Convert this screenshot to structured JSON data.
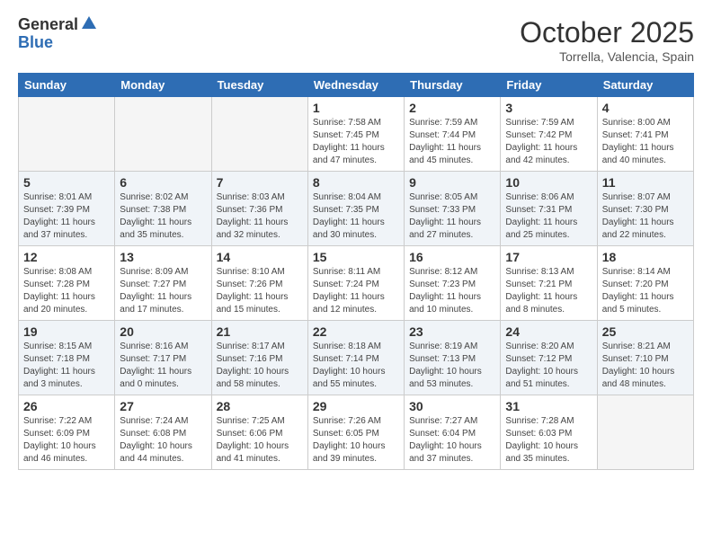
{
  "logo": {
    "general": "General",
    "blue": "Blue"
  },
  "title": "October 2025",
  "location": "Torrella, Valencia, Spain",
  "days_of_week": [
    "Sunday",
    "Monday",
    "Tuesday",
    "Wednesday",
    "Thursday",
    "Friday",
    "Saturday"
  ],
  "weeks": [
    [
      {
        "num": "",
        "info": ""
      },
      {
        "num": "",
        "info": ""
      },
      {
        "num": "",
        "info": ""
      },
      {
        "num": "1",
        "info": "Sunrise: 7:58 AM\nSunset: 7:45 PM\nDaylight: 11 hours\nand 47 minutes."
      },
      {
        "num": "2",
        "info": "Sunrise: 7:59 AM\nSunset: 7:44 PM\nDaylight: 11 hours\nand 45 minutes."
      },
      {
        "num": "3",
        "info": "Sunrise: 7:59 AM\nSunset: 7:42 PM\nDaylight: 11 hours\nand 42 minutes."
      },
      {
        "num": "4",
        "info": "Sunrise: 8:00 AM\nSunset: 7:41 PM\nDaylight: 11 hours\nand 40 minutes."
      }
    ],
    [
      {
        "num": "5",
        "info": "Sunrise: 8:01 AM\nSunset: 7:39 PM\nDaylight: 11 hours\nand 37 minutes."
      },
      {
        "num": "6",
        "info": "Sunrise: 8:02 AM\nSunset: 7:38 PM\nDaylight: 11 hours\nand 35 minutes."
      },
      {
        "num": "7",
        "info": "Sunrise: 8:03 AM\nSunset: 7:36 PM\nDaylight: 11 hours\nand 32 minutes."
      },
      {
        "num": "8",
        "info": "Sunrise: 8:04 AM\nSunset: 7:35 PM\nDaylight: 11 hours\nand 30 minutes."
      },
      {
        "num": "9",
        "info": "Sunrise: 8:05 AM\nSunset: 7:33 PM\nDaylight: 11 hours\nand 27 minutes."
      },
      {
        "num": "10",
        "info": "Sunrise: 8:06 AM\nSunset: 7:31 PM\nDaylight: 11 hours\nand 25 minutes."
      },
      {
        "num": "11",
        "info": "Sunrise: 8:07 AM\nSunset: 7:30 PM\nDaylight: 11 hours\nand 22 minutes."
      }
    ],
    [
      {
        "num": "12",
        "info": "Sunrise: 8:08 AM\nSunset: 7:28 PM\nDaylight: 11 hours\nand 20 minutes."
      },
      {
        "num": "13",
        "info": "Sunrise: 8:09 AM\nSunset: 7:27 PM\nDaylight: 11 hours\nand 17 minutes."
      },
      {
        "num": "14",
        "info": "Sunrise: 8:10 AM\nSunset: 7:26 PM\nDaylight: 11 hours\nand 15 minutes."
      },
      {
        "num": "15",
        "info": "Sunrise: 8:11 AM\nSunset: 7:24 PM\nDaylight: 11 hours\nand 12 minutes."
      },
      {
        "num": "16",
        "info": "Sunrise: 8:12 AM\nSunset: 7:23 PM\nDaylight: 11 hours\nand 10 minutes."
      },
      {
        "num": "17",
        "info": "Sunrise: 8:13 AM\nSunset: 7:21 PM\nDaylight: 11 hours\nand 8 minutes."
      },
      {
        "num": "18",
        "info": "Sunrise: 8:14 AM\nSunset: 7:20 PM\nDaylight: 11 hours\nand 5 minutes."
      }
    ],
    [
      {
        "num": "19",
        "info": "Sunrise: 8:15 AM\nSunset: 7:18 PM\nDaylight: 11 hours\nand 3 minutes."
      },
      {
        "num": "20",
        "info": "Sunrise: 8:16 AM\nSunset: 7:17 PM\nDaylight: 11 hours\nand 0 minutes."
      },
      {
        "num": "21",
        "info": "Sunrise: 8:17 AM\nSunset: 7:16 PM\nDaylight: 10 hours\nand 58 minutes."
      },
      {
        "num": "22",
        "info": "Sunrise: 8:18 AM\nSunset: 7:14 PM\nDaylight: 10 hours\nand 55 minutes."
      },
      {
        "num": "23",
        "info": "Sunrise: 8:19 AM\nSunset: 7:13 PM\nDaylight: 10 hours\nand 53 minutes."
      },
      {
        "num": "24",
        "info": "Sunrise: 8:20 AM\nSunset: 7:12 PM\nDaylight: 10 hours\nand 51 minutes."
      },
      {
        "num": "25",
        "info": "Sunrise: 8:21 AM\nSunset: 7:10 PM\nDaylight: 10 hours\nand 48 minutes."
      }
    ],
    [
      {
        "num": "26",
        "info": "Sunrise: 7:22 AM\nSunset: 6:09 PM\nDaylight: 10 hours\nand 46 minutes."
      },
      {
        "num": "27",
        "info": "Sunrise: 7:24 AM\nSunset: 6:08 PM\nDaylight: 10 hours\nand 44 minutes."
      },
      {
        "num": "28",
        "info": "Sunrise: 7:25 AM\nSunset: 6:06 PM\nDaylight: 10 hours\nand 41 minutes."
      },
      {
        "num": "29",
        "info": "Sunrise: 7:26 AM\nSunset: 6:05 PM\nDaylight: 10 hours\nand 39 minutes."
      },
      {
        "num": "30",
        "info": "Sunrise: 7:27 AM\nSunset: 6:04 PM\nDaylight: 10 hours\nand 37 minutes."
      },
      {
        "num": "31",
        "info": "Sunrise: 7:28 AM\nSunset: 6:03 PM\nDaylight: 10 hours\nand 35 minutes."
      },
      {
        "num": "",
        "info": ""
      }
    ]
  ]
}
